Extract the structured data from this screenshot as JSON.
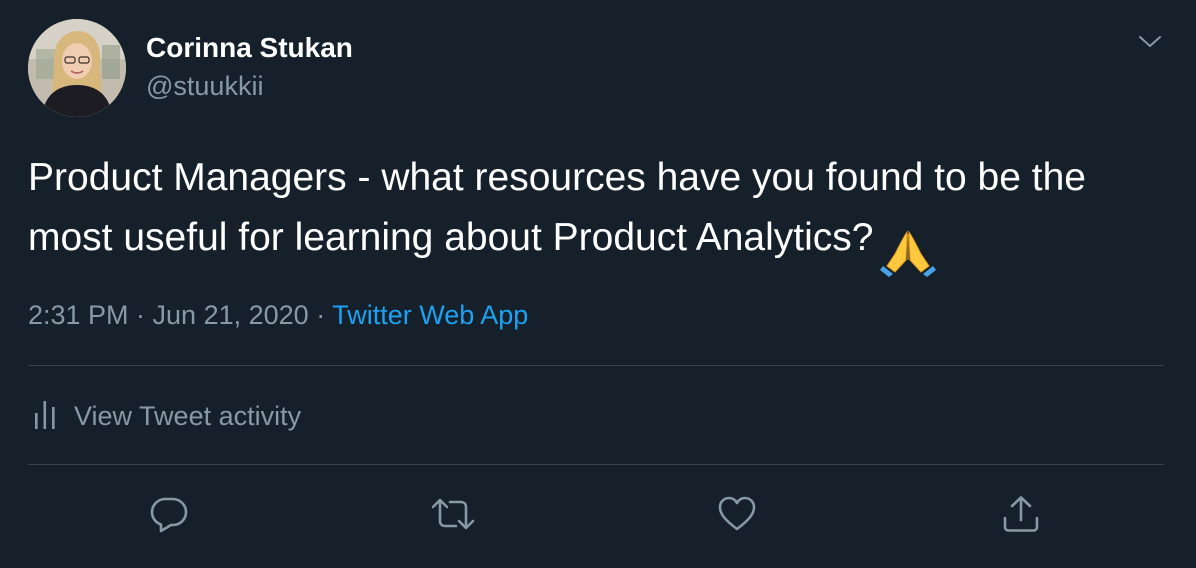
{
  "tweet": {
    "author": {
      "display_name": "Corinna Stukan",
      "handle": "@stuukkii"
    },
    "text": "Product Managers - what resources have you found to be the most useful for learning about Product Analytics?",
    "emoji": "🙏",
    "timestamp": "2:31 PM · Jun 21, 2020",
    "separator": " · ",
    "source": "Twitter Web App",
    "activity_label": "View Tweet activity"
  },
  "colors": {
    "background": "#15202b",
    "text_primary": "#ffffff",
    "text_secondary": "#8899a6",
    "accent": "#1da1f2",
    "divider": "#38444d"
  },
  "icons": {
    "caret": "chevron-down-icon",
    "activity": "bar-chart-icon",
    "reply": "reply-icon",
    "retweet": "retweet-icon",
    "like": "heart-icon",
    "share": "share-icon"
  }
}
